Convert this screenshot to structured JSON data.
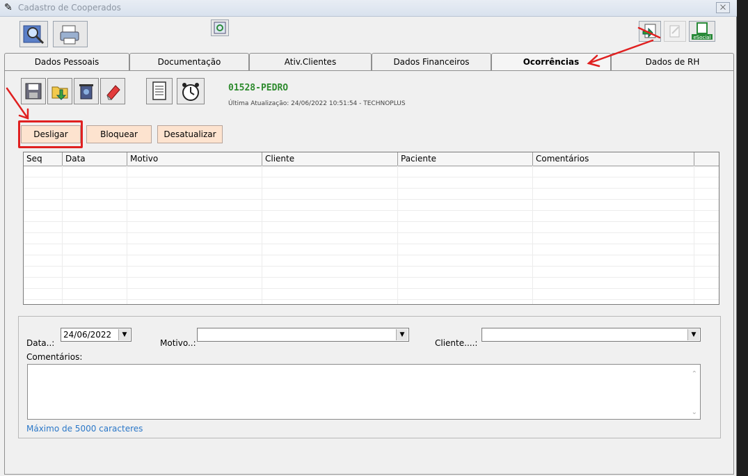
{
  "window": {
    "title": "Cadastro de Cooperados",
    "close_label": "⨉"
  },
  "toolbar": {
    "top_left": [
      "search-icon",
      "printer-icon"
    ],
    "top_center": "refresh-icon",
    "top_right": [
      "import-icon",
      "edit-icon",
      "esocial-icon"
    ],
    "esocial_label": "eSocial"
  },
  "tabs": [
    {
      "label": "Dados Pessoais",
      "active": false
    },
    {
      "label": "Documentação",
      "active": false
    },
    {
      "label": "Ativ.Clientes",
      "active": false
    },
    {
      "label": "Dados Financeiros",
      "active": false
    },
    {
      "label": "Ocorrências",
      "active": true
    },
    {
      "label": "Dados de RH",
      "active": false
    }
  ],
  "record": {
    "code": "01528-PEDRO",
    "last_update": "Última Atualização: 24/06/2022 10:51:54 - TECHNOPLUS"
  },
  "actions": {
    "desligar": "Desligar",
    "bloquear": "Bloquear",
    "desatualizar": "Desatualizar"
  },
  "grid": {
    "columns": [
      "Seq",
      "Data",
      "Motivo",
      "Cliente",
      "Paciente",
      "Comentários"
    ]
  },
  "form": {
    "data_label": "Data..:",
    "data_value": "24/06/2022",
    "motivo_label": "Motivo..:",
    "motivo_value": "",
    "cliente_label": "Cliente....:",
    "cliente_value": "",
    "comentarios_label": "Comentários:",
    "comentarios_value": "",
    "max_note": "Máximo de 5000 caracteres"
  },
  "colors": {
    "highlight": "#e02020",
    "action_bg": "#fde3cf",
    "code_green": "#2e8b2e",
    "note_blue": "#2a77c8"
  }
}
